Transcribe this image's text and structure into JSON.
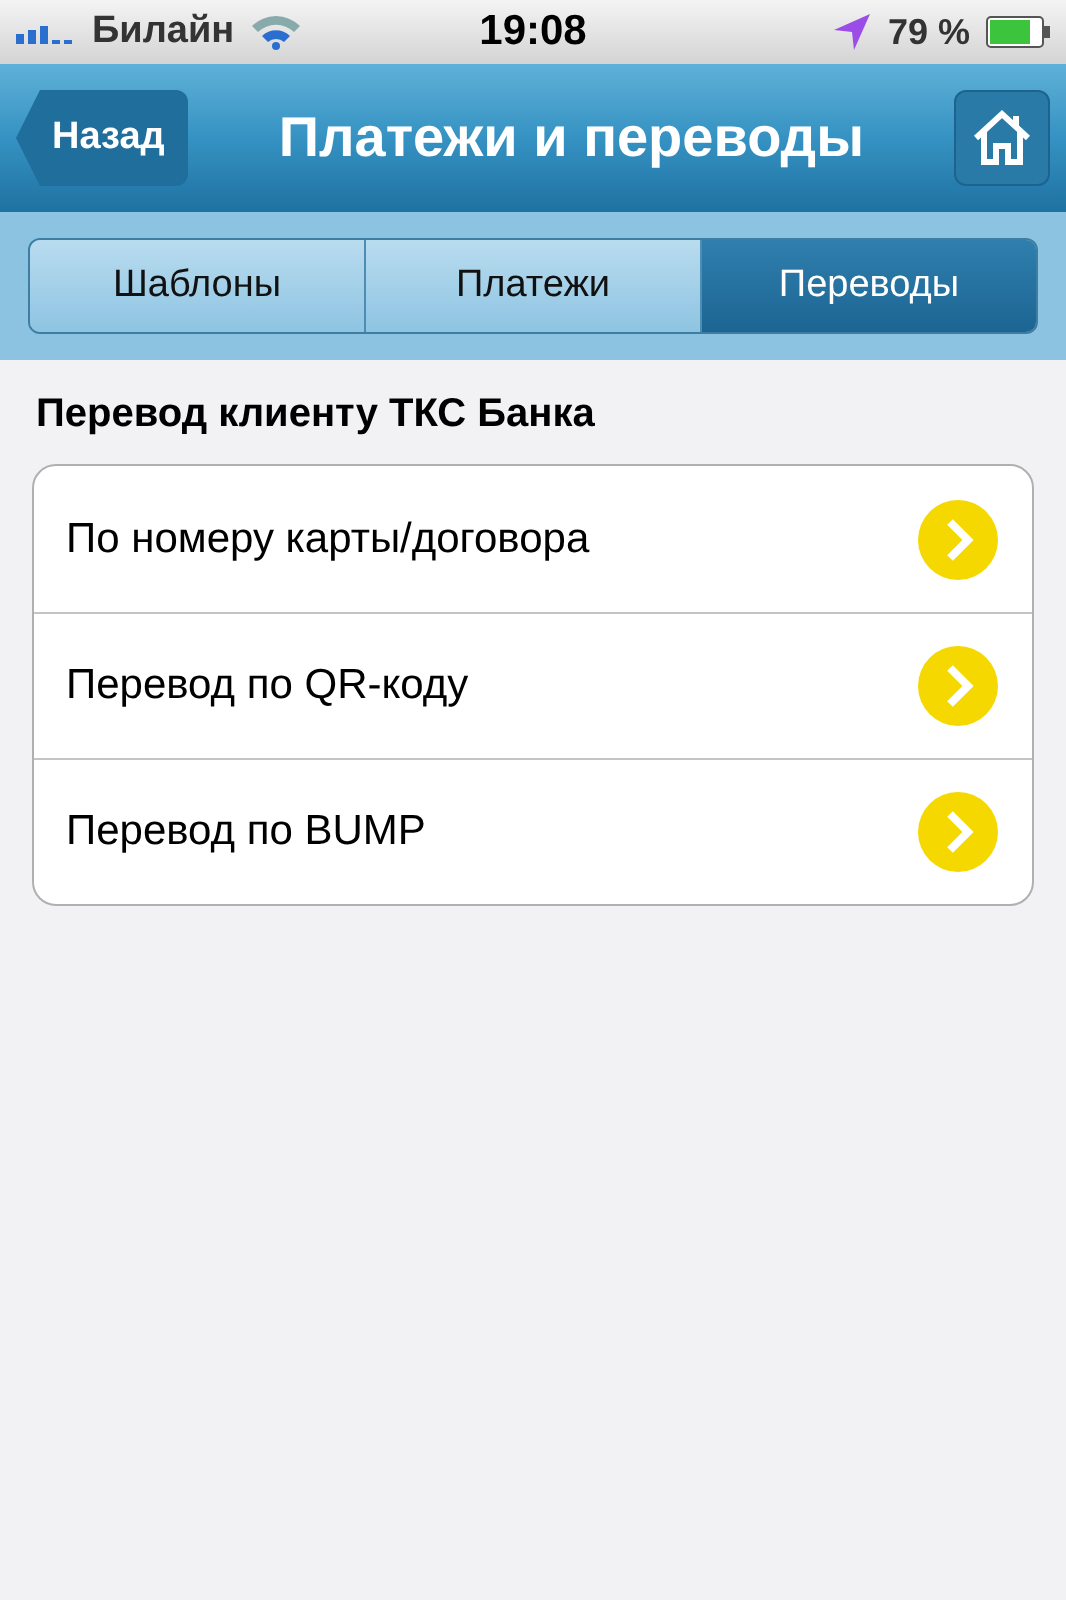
{
  "status_bar": {
    "carrier": "Билайн",
    "time": "19:08",
    "battery": "79 %"
  },
  "nav_bar": {
    "back": "Назад",
    "title": "Платежи и переводы"
  },
  "tabs": [
    {
      "label": "Шаблоны",
      "selected": false
    },
    {
      "label": "Платежи",
      "selected": false
    },
    {
      "label": "Переводы",
      "selected": true
    }
  ],
  "section": {
    "title": "Перевод клиенту ТКС Банка",
    "items": [
      {
        "label": "По номеру карты/договора"
      },
      {
        "label": "Перевод по QR-коду"
      },
      {
        "label": "Перевод по BUMP"
      }
    ]
  }
}
